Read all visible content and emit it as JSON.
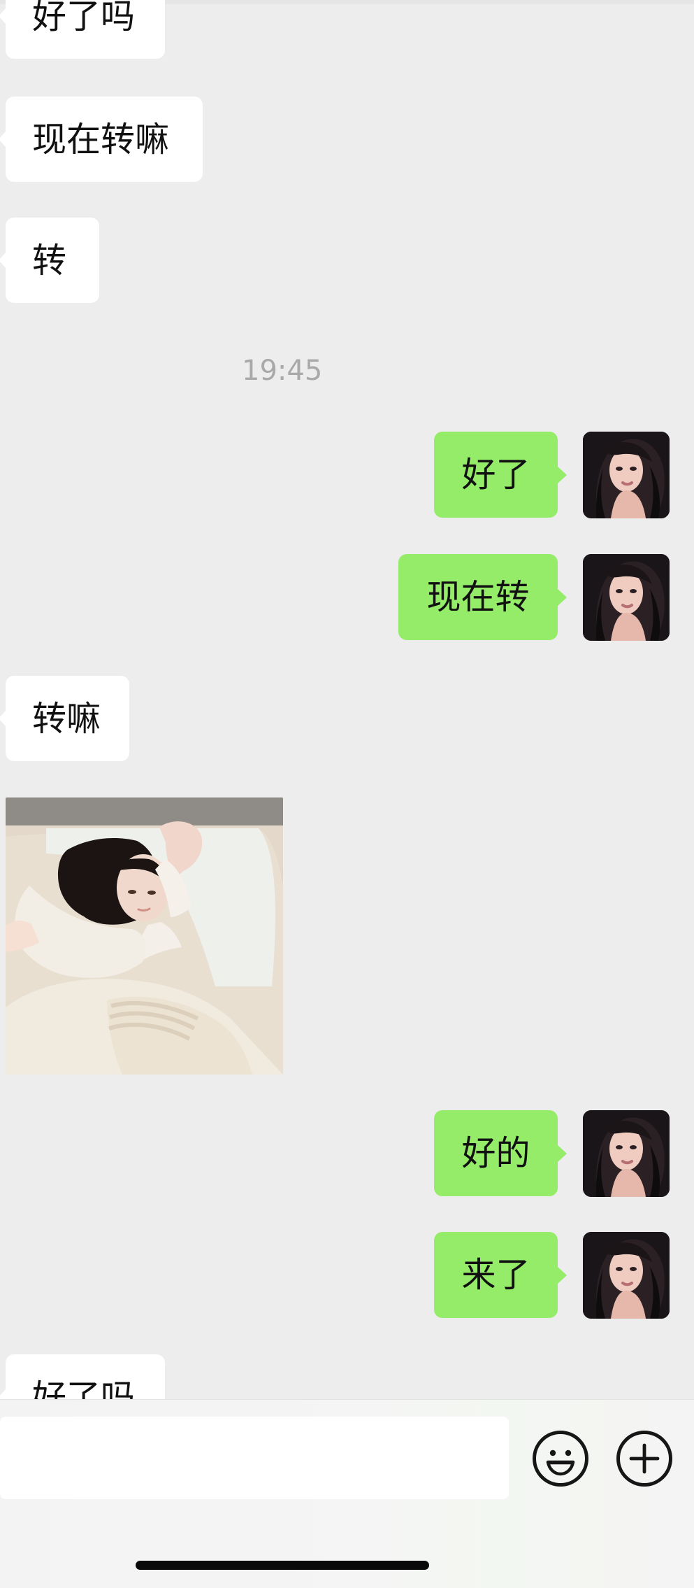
{
  "chat": {
    "messages": [
      {
        "id": "m1",
        "direction": "incoming",
        "text": "好了吗"
      },
      {
        "id": "m2",
        "direction": "incoming",
        "text": "现在转嘛"
      },
      {
        "id": "m3",
        "direction": "incoming",
        "text": "转"
      },
      {
        "id": "m4",
        "direction": "outgoing",
        "text": "好了"
      },
      {
        "id": "m5",
        "direction": "outgoing",
        "text": "现在转"
      },
      {
        "id": "m6",
        "direction": "incoming",
        "text": "转嘛"
      },
      {
        "id": "m7",
        "direction": "incoming",
        "type": "image",
        "image_subject": "toddler lying in bed"
      },
      {
        "id": "m8",
        "direction": "outgoing",
        "text": "好的"
      },
      {
        "id": "m9",
        "direction": "outgoing",
        "text": "来了"
      },
      {
        "id": "m10",
        "direction": "incoming",
        "text": "好了吗"
      }
    ],
    "timestamp": "19:45"
  },
  "composer": {
    "input_value": "",
    "icons": [
      "emoji-icon",
      "plus-icon"
    ]
  },
  "colors": {
    "background": "#ededed",
    "incoming_bubble": "#ffffff",
    "outgoing_bubble": "#95ec69",
    "timestamp": "#a9a9a9",
    "icon": "#161616"
  }
}
